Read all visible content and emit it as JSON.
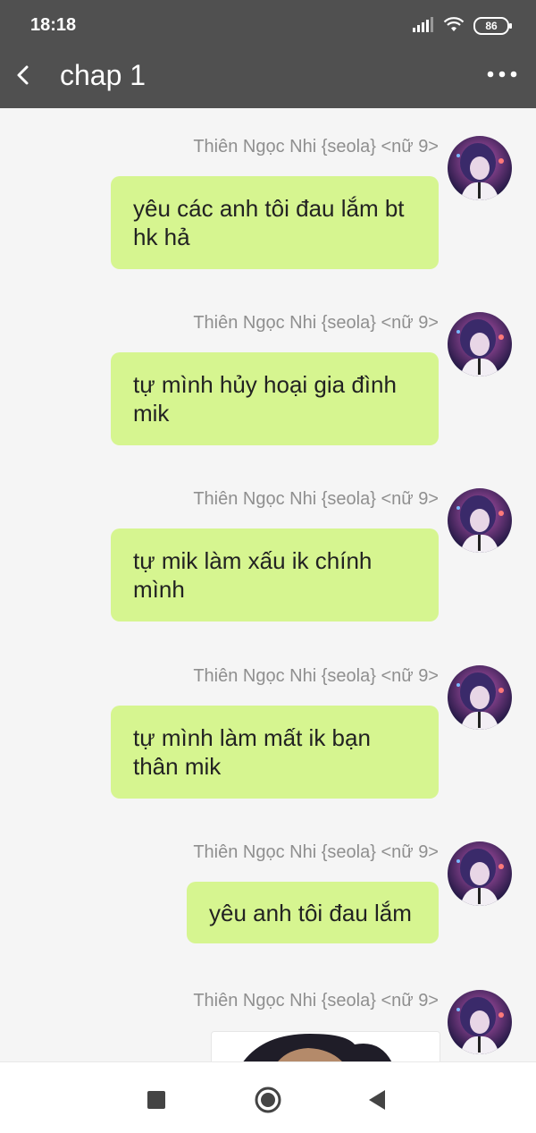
{
  "status_bar": {
    "time": "18:18",
    "battery": "86"
  },
  "app_bar": {
    "title": "chap 1"
  },
  "messages": [
    {
      "sender": "Thiên Ngọc Nhi {seola} <nữ 9>",
      "text": "yêu các anh tôi đau lắm bt\nhk hả"
    },
    {
      "sender": "Thiên Ngọc Nhi {seola} <nữ 9>",
      "text": "tự mình hủy hoại gia đình\nmik"
    },
    {
      "sender": "Thiên Ngọc Nhi {seola} <nữ 9>",
      "text": "tự mik làm xấu ik chính\nmình"
    },
    {
      "sender": "Thiên Ngọc Nhi {seola} <nữ 9>",
      "text": "tự mình làm mất ik bạn\nthân mik"
    },
    {
      "sender": "Thiên Ngọc Nhi {seola} <nữ 9>",
      "text": "yêu anh tôi đau lắm"
    },
    {
      "sender": "Thiên Ngọc Nhi {seola} <nữ 9>",
      "text": ""
    }
  ],
  "colors": {
    "bar": "#505050",
    "bubble": "#d6f590",
    "background": "#f5f5f5"
  },
  "icons": {
    "back": "chevron-left-icon",
    "more": "more-dots-icon",
    "nav": [
      "stop-square-icon",
      "home-circle-icon",
      "back-triangle-icon"
    ]
  }
}
